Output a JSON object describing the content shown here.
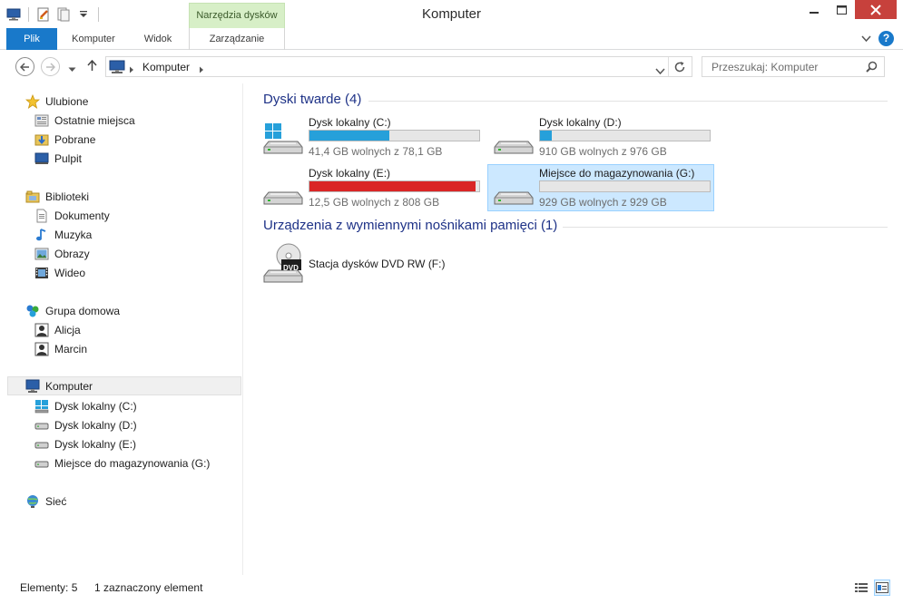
{
  "window": {
    "title": "Komputer",
    "context_tab": "Narzędzia dysków"
  },
  "ribbon": {
    "tabs": [
      "Plik",
      "Komputer",
      "Widok",
      "Zarządzanie"
    ]
  },
  "address": {
    "crumb": "Komputer",
    "search_placeholder": "Przeszukaj: Komputer"
  },
  "sidebar": {
    "favorites": {
      "label": "Ulubione",
      "items": [
        "Ostatnie miejsca",
        "Pobrane",
        "Pulpit"
      ]
    },
    "libraries": {
      "label": "Biblioteki",
      "items": [
        "Dokumenty",
        "Muzyka",
        "Obrazy",
        "Wideo"
      ]
    },
    "homegroup": {
      "label": "Grupa domowa",
      "items": [
        "Alicja",
        "Marcin"
      ]
    },
    "computer": {
      "label": "Komputer",
      "items": [
        "Dysk lokalny (C:)",
        "Dysk lokalny (D:)",
        "Dysk lokalny (E:)",
        "Miejsce do magazynowania (G:)"
      ]
    },
    "network": {
      "label": "Sieć"
    }
  },
  "main": {
    "hard_drives": {
      "header": "Dyski twarde (4)",
      "drives": [
        {
          "name": "Dysk lokalny (C:)",
          "free": "41,4 GB wolnych z 78,1 GB",
          "used_fraction": 0.47,
          "bar_color": "#26a0da",
          "selected": false
        },
        {
          "name": "Dysk lokalny (D:)",
          "free": "910 GB wolnych z 976 GB",
          "used_fraction": 0.07,
          "bar_color": "#26a0da",
          "selected": false
        },
        {
          "name": "Dysk lokalny (E:)",
          "free": "12,5 GB wolnych z 808 GB",
          "used_fraction": 0.98,
          "bar_color": "#da2626",
          "selected": false
        },
        {
          "name": "Miejsce do magazynowania (G:)",
          "free": "929 GB wolnych z 929 GB",
          "used_fraction": 0.0,
          "bar_color": "#26a0da",
          "selected": true
        }
      ]
    },
    "removable": {
      "header": "Urządzenia z wymiennymi nośnikami pamięci (1)",
      "devices": [
        {
          "name": "Stacja dysków DVD RW (F:)",
          "icon_label": "DVD"
        }
      ]
    }
  },
  "status": {
    "items_count": "Elementy: 5",
    "selected": "1 zaznaczony element"
  },
  "colors": {
    "accent": "#1979ca",
    "selection_bg": "#cce8ff",
    "selection_border": "#99d1ff",
    "close_button": "#c7413c",
    "group_header": "#1e3287"
  }
}
